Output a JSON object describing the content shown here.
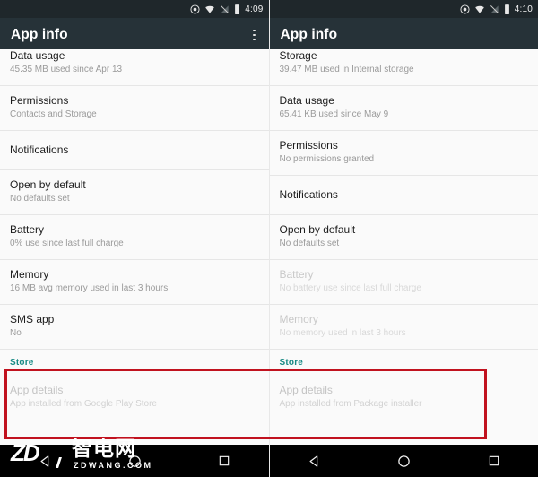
{
  "panels": [
    {
      "id": "left",
      "statusbar": {
        "time": "4:09",
        "icons": [
          "location-target-icon",
          "wifi-icon",
          "signal-off-icon",
          "battery-icon"
        ]
      },
      "appbar": {
        "title": "App info",
        "has_overflow": true,
        "overflow_name": "overflow-menu-icon"
      },
      "rows": [
        {
          "title": "Data usage",
          "subtitle": "45.35 MB used since Apr 13",
          "dim": false,
          "clipped": true
        },
        {
          "title": "Permissions",
          "subtitle": "Contacts and Storage",
          "dim": false,
          "clipped": false
        },
        {
          "title": "Notifications",
          "subtitle": "",
          "dim": false,
          "clipped": false
        },
        {
          "title": "Open by default",
          "subtitle": "No defaults set",
          "dim": false,
          "clipped": false
        },
        {
          "title": "Battery",
          "subtitle": "0% use since last full charge",
          "dim": false,
          "clipped": false
        },
        {
          "title": "Memory",
          "subtitle": "16 MB avg memory used in last 3 hours",
          "dim": false,
          "clipped": false
        },
        {
          "title": "SMS app",
          "subtitle": "No",
          "dim": false,
          "clipped": false
        }
      ],
      "store": {
        "header": "Store",
        "detail_title": "App details",
        "detail_subtitle": "App installed from Google Play Store"
      },
      "navbar": {
        "back": "back-triangle-icon",
        "home": "home-circle-icon",
        "recents": "recents-square-icon"
      }
    },
    {
      "id": "right",
      "statusbar": {
        "time": "4:10",
        "icons": [
          "location-target-icon",
          "wifi-icon",
          "signal-off-icon",
          "battery-icon"
        ]
      },
      "appbar": {
        "title": "App info",
        "has_overflow": false,
        "overflow_name": "overflow-menu-icon"
      },
      "rows": [
        {
          "title": "Storage",
          "subtitle": "39.47 MB used in Internal storage",
          "dim": false,
          "clipped": true
        },
        {
          "title": "Data usage",
          "subtitle": "65.41 KB used since May 9",
          "dim": false,
          "clipped": false
        },
        {
          "title": "Permissions",
          "subtitle": "No permissions granted",
          "dim": false,
          "clipped": false
        },
        {
          "title": "Notifications",
          "subtitle": "",
          "dim": false,
          "clipped": false
        },
        {
          "title": "Open by default",
          "subtitle": "No defaults set",
          "dim": false,
          "clipped": false
        },
        {
          "title": "Battery",
          "subtitle": "No battery use since last full charge",
          "dim": true,
          "clipped": false
        },
        {
          "title": "Memory",
          "subtitle": "No memory used in last 3 hours",
          "dim": true,
          "clipped": false
        }
      ],
      "store": {
        "header": "Store",
        "detail_title": "App details",
        "detail_subtitle": "App installed from Package installer"
      },
      "navbar": {
        "back": "back-triangle-icon",
        "home": "home-circle-icon",
        "recents": "recents-square-icon"
      }
    }
  ],
  "annotation": {
    "name": "red-highlight-box",
    "color": "#c1121f"
  },
  "watermark": {
    "mark": "ZD",
    "brand": "智电网",
    "domain": "ZDWANG.COM"
  },
  "colors": {
    "appbar": "#263238",
    "statusbar": "#1f272b",
    "store_accent": "#178a84",
    "navbar": "#000000",
    "list_bg": "#fafafa"
  }
}
